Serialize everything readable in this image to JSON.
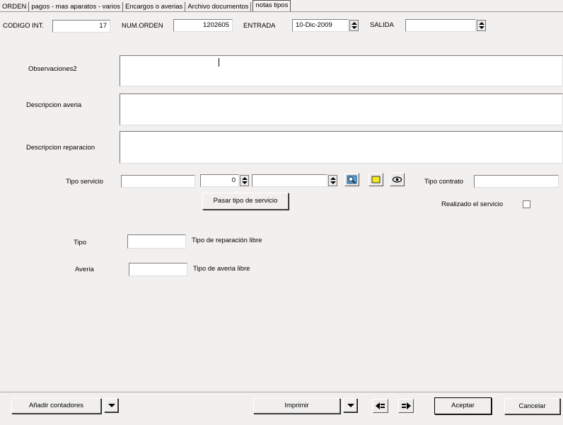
{
  "tabs": [
    {
      "label": "ORDEN",
      "active": false
    },
    {
      "label": "pagos - mas aparatos - varios",
      "active": false
    },
    {
      "label": "Encargos o averias",
      "active": false
    },
    {
      "label": "Archivo documentos",
      "active": false
    },
    {
      "label": "notas tipos",
      "active": true
    }
  ],
  "header": {
    "codigo_label": "CODIGO INT.",
    "codigo_value": "17",
    "num_orden_label": "NUM.ORDEN",
    "num_orden_value": "1202605",
    "entrada_label": "ENTRADA",
    "entrada_value": "10-Dic-2009",
    "salida_label": "SALIDA",
    "salida_value": ""
  },
  "notes": {
    "observaciones_label": "Observaciones2",
    "observaciones_value": "",
    "averia_label": "Descripcion averia",
    "averia_value": "",
    "reparacion_label": "Descripcion reparacion",
    "reparacion_value": ""
  },
  "servicio": {
    "tipo_servicio_label": "Tipo servicio",
    "tipo_servicio_value": "",
    "quantity_value": "0",
    "tipo_contrato_label": "Tipo contrato",
    "tipo_contrato_value": "",
    "pasar_button": "Pasar tipo de servicio",
    "realizado_label": "Realizado el servicio",
    "realizado_checked": false
  },
  "libre": {
    "tipo_label": "Tipo",
    "tipo_value": "",
    "tipo_desc": "Tipo de reparación libre",
    "averia_label": "Averia",
    "averia_value": "",
    "averia_desc": "Tipo de averia libre"
  },
  "footer": {
    "anadir_button": "Añadir contadores",
    "imprimir_button": "Imprimir",
    "aceptar_button": "Aceptar",
    "cancelar_button": "Cancelar"
  },
  "icons": {
    "search": "search-icon",
    "note": "note-icon",
    "view": "eye-icon",
    "prev": "arrow-left-icon",
    "next": "arrow-right-icon"
  }
}
